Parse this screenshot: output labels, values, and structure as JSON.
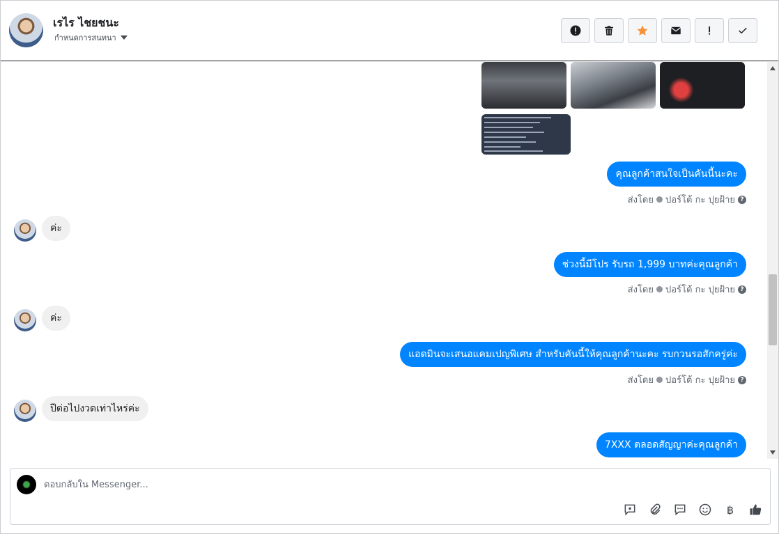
{
  "header": {
    "contact_name": "เรไร ไชยชนะ",
    "assign_label": "กำหนดการสนทนา"
  },
  "actions": [
    {
      "name": "spam-button",
      "icon": "alert-circle-icon"
    },
    {
      "name": "delete-button",
      "icon": "trash-icon"
    },
    {
      "name": "follow-up-button",
      "icon": "star-icon"
    },
    {
      "name": "mark-unread-button",
      "icon": "envelope-icon"
    },
    {
      "name": "priority-button",
      "icon": "exclamation-icon"
    },
    {
      "name": "done-button",
      "icon": "check-icon"
    }
  ],
  "messages": {
    "out1": "คุณลูกค้าสนใจเป็นคันนี้นะคะ",
    "in1": "ค่ะ",
    "out2": "ช่วงนี้มีโปร รับรถ 1,999 บาทค่ะคุณลูกค้า",
    "in2": "ค่ะ",
    "out3": "แอดมินจะเสนอแคมเปญพิเศษ สำหรับคันนี้ให้คุณลูกค้านะคะ รบกวนรอสักครู่ค่ะ",
    "in3": "ปีต่อไปงวดเท่าไหร่ค่ะ",
    "out4": "7XXX ตลอดสัญญาค่ะคุณลูกค้า"
  },
  "sent_by": {
    "prefix": "ส่งโดย",
    "agent": "ปอร์โต้ กะ ปุยฝ้าย"
  },
  "composer": {
    "placeholder": "ตอบกลับใน Messenger...",
    "baht_symbol": "฿"
  },
  "colors": {
    "accent": "#0084ff",
    "star": "#f7923b"
  }
}
